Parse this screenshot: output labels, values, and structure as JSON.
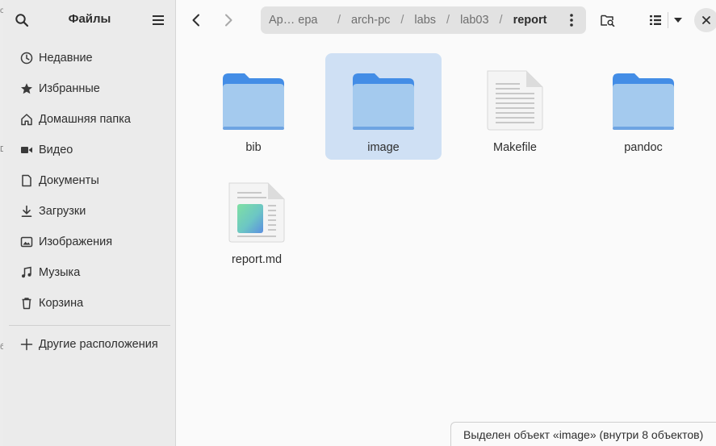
{
  "sidebar": {
    "title": "Файлы",
    "places": [
      {
        "label": "Недавние",
        "icon": "recent-icon"
      },
      {
        "label": "Избранные",
        "icon": "star-icon"
      },
      {
        "label": "Домашняя папка",
        "icon": "home-icon"
      },
      {
        "label": "Видео",
        "icon": "video-icon"
      },
      {
        "label": "Документы",
        "icon": "document-icon"
      },
      {
        "label": "Загрузки",
        "icon": "download-icon"
      },
      {
        "label": "Изображения",
        "icon": "image-icon"
      },
      {
        "label": "Музыка",
        "icon": "music-icon"
      },
      {
        "label": "Корзина",
        "icon": "trash-icon"
      }
    ],
    "other_locations": "Другие расположения"
  },
  "pathbar": {
    "crumbs": [
      "Ар… ера",
      "arch-pc",
      "labs",
      "lab03",
      "report"
    ]
  },
  "files": [
    {
      "name": "bib",
      "kind": "folder",
      "selected": false
    },
    {
      "name": "image",
      "kind": "folder",
      "selected": true
    },
    {
      "name": "Makefile",
      "kind": "text",
      "selected": false
    },
    {
      "name": "pandoc",
      "kind": "folder",
      "selected": false
    },
    {
      "name": "report.md",
      "kind": "markdown",
      "selected": false
    }
  ],
  "status": "Выделен объект «image»  (внутри 8 объектов)",
  "colors": {
    "accent": "#3584e4",
    "folder_back": "#438de6",
    "folder_front": "#a4caee",
    "selection": "#cfe0f4"
  }
}
